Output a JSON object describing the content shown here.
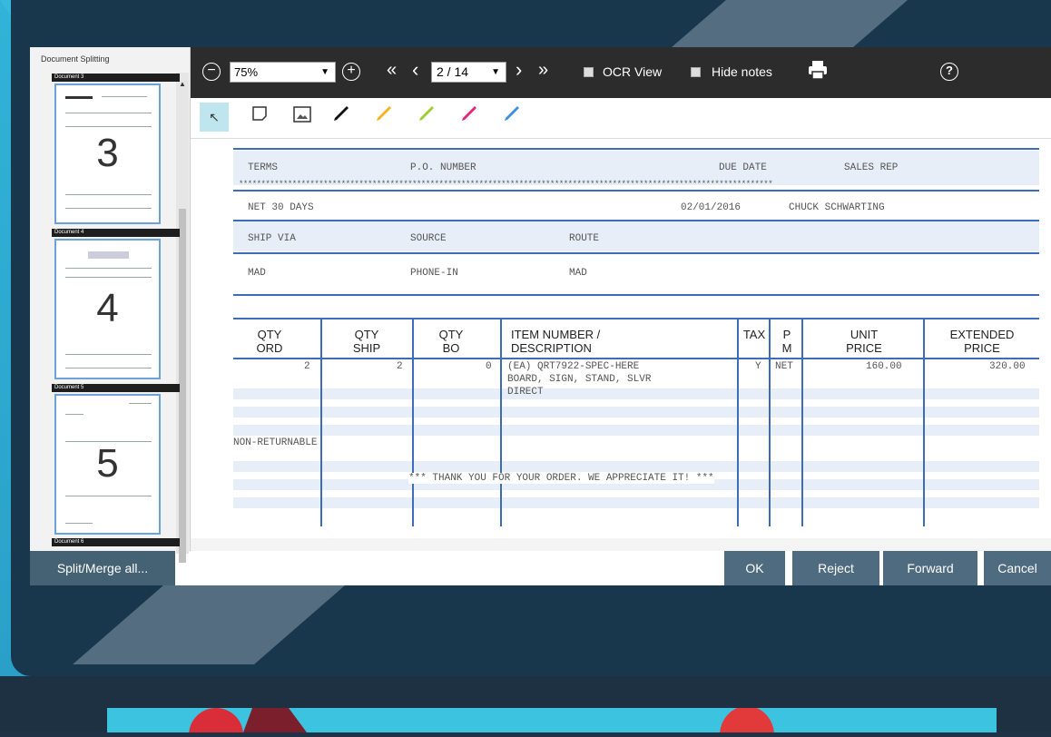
{
  "sidebar": {
    "title": "Document Splitting",
    "documents": [
      {
        "header": "Document 3",
        "page_number": "3"
      },
      {
        "header": "Document 4",
        "page_number": "4"
      },
      {
        "header": "Document 5",
        "page_number": "5"
      },
      {
        "header": "Document 6",
        "page_number": ""
      }
    ],
    "split_merge_label": "Split/Merge all..."
  },
  "toolbar": {
    "zoom_out_symbol": "−",
    "zoom_value": "75%",
    "zoom_in_symbol": "+",
    "first_page": "«",
    "prev_page": "‹",
    "page_value": "2 / 14",
    "next_page": "›",
    "last_page": "»",
    "ocr_view_label": "OCR View",
    "hide_notes_label": "Hide notes",
    "help_symbol": "?"
  },
  "annotation_tools": [
    "select-pointer",
    "sticky-note",
    "image",
    "pen-black",
    "highlighter-orange",
    "highlighter-green",
    "highlighter-pink",
    "highlighter-blue"
  ],
  "annotation_colors": {
    "pen-black": "#111111",
    "highlighter-orange": "#f6b21b",
    "highlighter-green": "#9ccc2e",
    "highlighter-pink": "#e6227a",
    "highlighter-blue": "#3d8fe0"
  },
  "document": {
    "terms_label": "TERMS",
    "po_label": "P.O. NUMBER",
    "due_date_label": "DUE DATE",
    "sales_rep_label": "SALES REP",
    "terms_value": "NET 30 DAYS",
    "due_date_value": "02/01/2016",
    "sales_rep_value": "CHUCK SCHWARTING",
    "ship_via_label": "SHIP VIA",
    "source_label": "SOURCE",
    "route_label": "ROUTE",
    "ship_via_value": "MAD",
    "source_value": "PHONE-IN",
    "route_value": "MAD",
    "columns": {
      "qty_ord": [
        "QTY",
        "ORD"
      ],
      "qty_ship": [
        "QTY",
        "SHIP"
      ],
      "qty_bo": [
        "QTY",
        "BO"
      ],
      "item": [
        "ITEM NUMBER /",
        "DESCRIPTION"
      ],
      "tax": [
        "TAX",
        ""
      ],
      "pm": [
        "P",
        "M"
      ],
      "unit_price": [
        "UNIT",
        "PRICE"
      ],
      "extended_price": [
        "EXTENDED",
        "PRICE"
      ]
    },
    "line_item": {
      "qty_ord": "2",
      "qty_ship": "2",
      "qty_bo": "0",
      "item_line1": "(EA) QRT7922-SPEC-HERE",
      "item_line2": "BOARD, SIGN, STAND, SLVR",
      "item_line3": "DIRECT",
      "tax": "Y",
      "pm": "NET",
      "unit_price": "160.00",
      "extended_price": "320.00"
    },
    "note": "NON-RETURNABLE",
    "thank_you": "*** THANK YOU FOR YOUR ORDER. WE APPRECIATE IT! ***",
    "stars": "************************************************************************************************************************"
  },
  "actions": {
    "ok": "OK",
    "reject": "Reject",
    "forward": "Forward",
    "cancel": "Cancel"
  }
}
